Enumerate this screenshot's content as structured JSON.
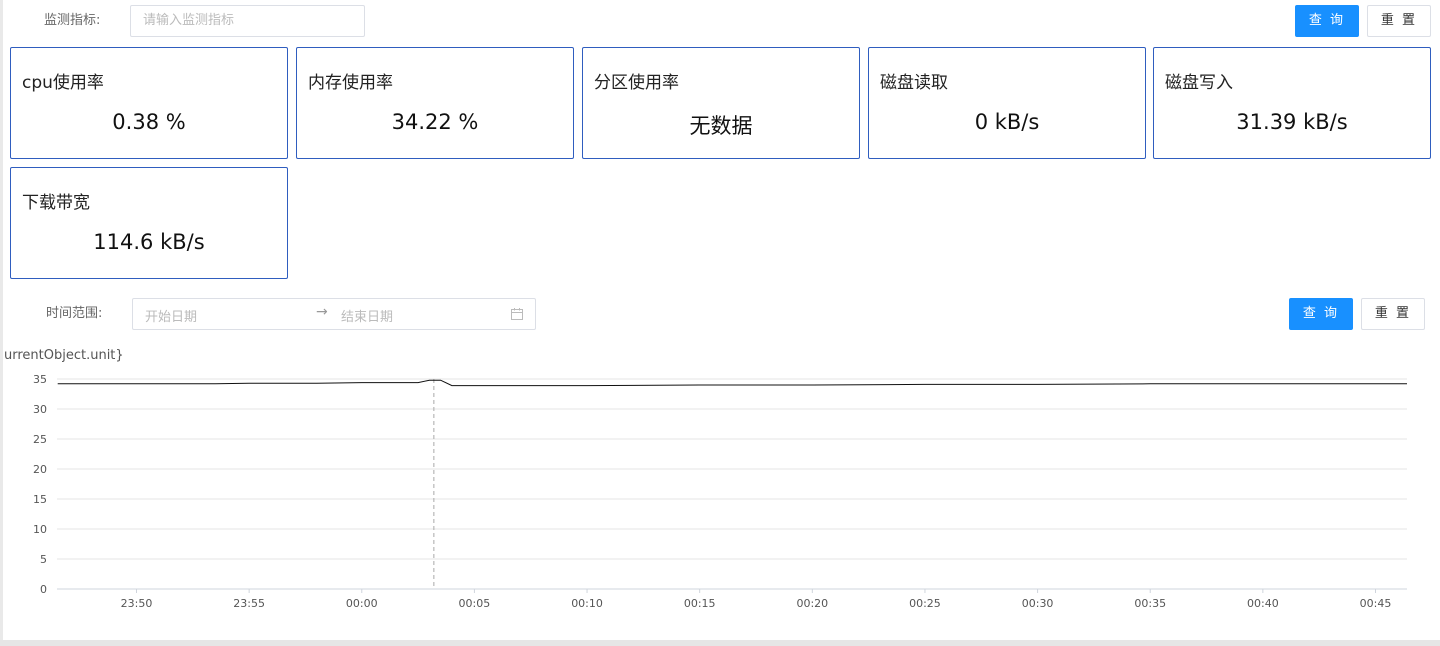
{
  "filter": {
    "label": "监测指标:",
    "placeholder": "请输入监测指标",
    "query_label": "查 询",
    "reset_label": "重 置"
  },
  "metrics": [
    {
      "title": "cpu使用率",
      "value": "0.38 %"
    },
    {
      "title": "内存使用率",
      "value": "34.22 %"
    },
    {
      "title": "分区使用率",
      "value": "无数据"
    },
    {
      "title": "磁盘读取",
      "value": "0 kB/s"
    },
    {
      "title": "磁盘写入",
      "value": "31.39 kB/s"
    },
    {
      "title": "下载带宽",
      "value": "114.6 kB/s"
    }
  ],
  "time_filter": {
    "label": "时间范围:",
    "start_placeholder": "开始日期",
    "separator": "→",
    "end_placeholder": "结束日期",
    "query_label": "查 询",
    "reset_label": "重 置"
  },
  "colors": {
    "primary": "#1890ff",
    "card_border": "#2f5dbf"
  },
  "chart_data": {
    "type": "line",
    "ylabel": "urrentObject.unit}",
    "ylim": [
      0,
      35
    ],
    "y_ticks": [
      "0",
      "5",
      "10",
      "15",
      "20",
      "25",
      "30",
      "35"
    ],
    "x_ticks": [
      "23:50",
      "23:55",
      "00:00",
      "00:05",
      "00:10",
      "00:15",
      "00:20",
      "00:25",
      "00:30",
      "00:35",
      "00:40",
      "00:45"
    ],
    "x_minutes": [
      0,
      5,
      10,
      15,
      20,
      25,
      30,
      35,
      40,
      45,
      50,
      55
    ],
    "grid": true,
    "series": [
      {
        "x": [
          -3.5,
          0,
          3.5,
          5,
          8,
          10,
          12.5,
          13,
          13.5,
          14,
          15,
          20,
          25,
          30,
          35,
          40,
          45,
          50,
          55,
          56.5
        ],
        "values": [
          34.2,
          34.2,
          34.2,
          34.3,
          34.3,
          34.4,
          34.4,
          34.8,
          34.8,
          33.9,
          33.9,
          33.9,
          34.0,
          34.0,
          34.1,
          34.1,
          34.2,
          34.2,
          34.2,
          34.2
        ]
      }
    ],
    "cursor_x": 13.2
  }
}
